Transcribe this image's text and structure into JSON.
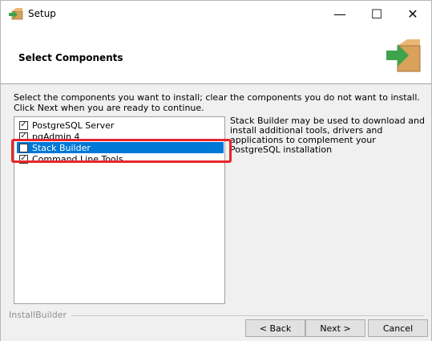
{
  "window": {
    "title": "Setup",
    "controls": {
      "minimize": "—",
      "maximize": "☐",
      "close": "✕"
    }
  },
  "header": {
    "title": "Select Components"
  },
  "instructions": "Select the components you want to install; clear the components you do not want to install. Click Next when you are ready to continue.",
  "components": [
    {
      "label": "PostgreSQL Server",
      "checked": true,
      "selected": false
    },
    {
      "label": "pgAdmin 4",
      "checked": true,
      "selected": false
    },
    {
      "label": "Stack Builder",
      "checked": false,
      "selected": true
    },
    {
      "label": "Command Line Tools",
      "checked": true,
      "selected": false
    }
  ],
  "description": "Stack Builder may be used to download and install additional tools, drivers and applications to complement your PostgreSQL installation",
  "footer": {
    "brand": "InstallBuilder",
    "back_label": "< Back",
    "next_label": "Next >",
    "cancel_label": "Cancel"
  },
  "colors": {
    "selection": "#0078d7",
    "highlight_box": "#e8262b",
    "icon_green": "#3fa34d",
    "icon_box": "#d8a25a"
  }
}
